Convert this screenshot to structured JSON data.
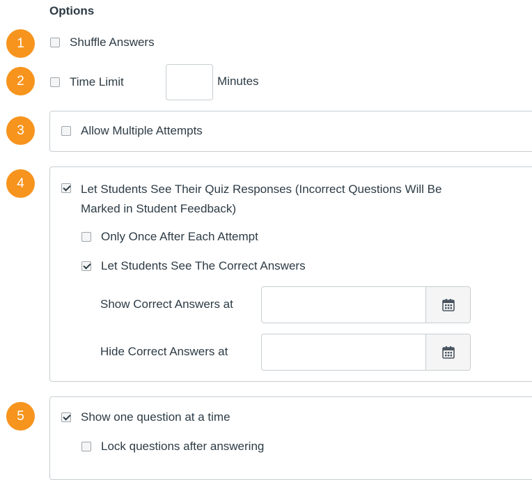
{
  "options": {
    "heading": "Options",
    "badges": [
      "1",
      "2",
      "3",
      "4",
      "5"
    ],
    "shuffle_answers": {
      "label": "Shuffle Answers",
      "checked": false
    },
    "time_limit": {
      "label": "Time Limit",
      "value": "",
      "unit": "Minutes",
      "checked": false
    },
    "multiple_attempts": {
      "label": "Allow Multiple Attempts",
      "checked": false
    },
    "see_responses": {
      "label_line1": "Let Students See Their Quiz Responses (Incorrect Questions Will Be",
      "label_line2": "Marked in Student Feedback)",
      "checked": true,
      "only_once": {
        "label": "Only Once After Each Attempt",
        "checked": false
      },
      "see_correct": {
        "label": "Let Students See The Correct Answers",
        "checked": true
      },
      "show_correct_at": {
        "label": "Show Correct Answers at",
        "value": "",
        "icon": "calendar-icon"
      },
      "hide_correct_at": {
        "label": "Hide Correct Answers at",
        "value": "",
        "icon": "calendar-icon"
      }
    },
    "one_question": {
      "label": "Show one question at a time",
      "checked": true,
      "lock_questions": {
        "label": "Lock questions after answering",
        "checked": false
      }
    }
  },
  "colors": {
    "badge": "#f7941d",
    "text": "#2d3b45",
    "border": "#c7cdd1"
  }
}
